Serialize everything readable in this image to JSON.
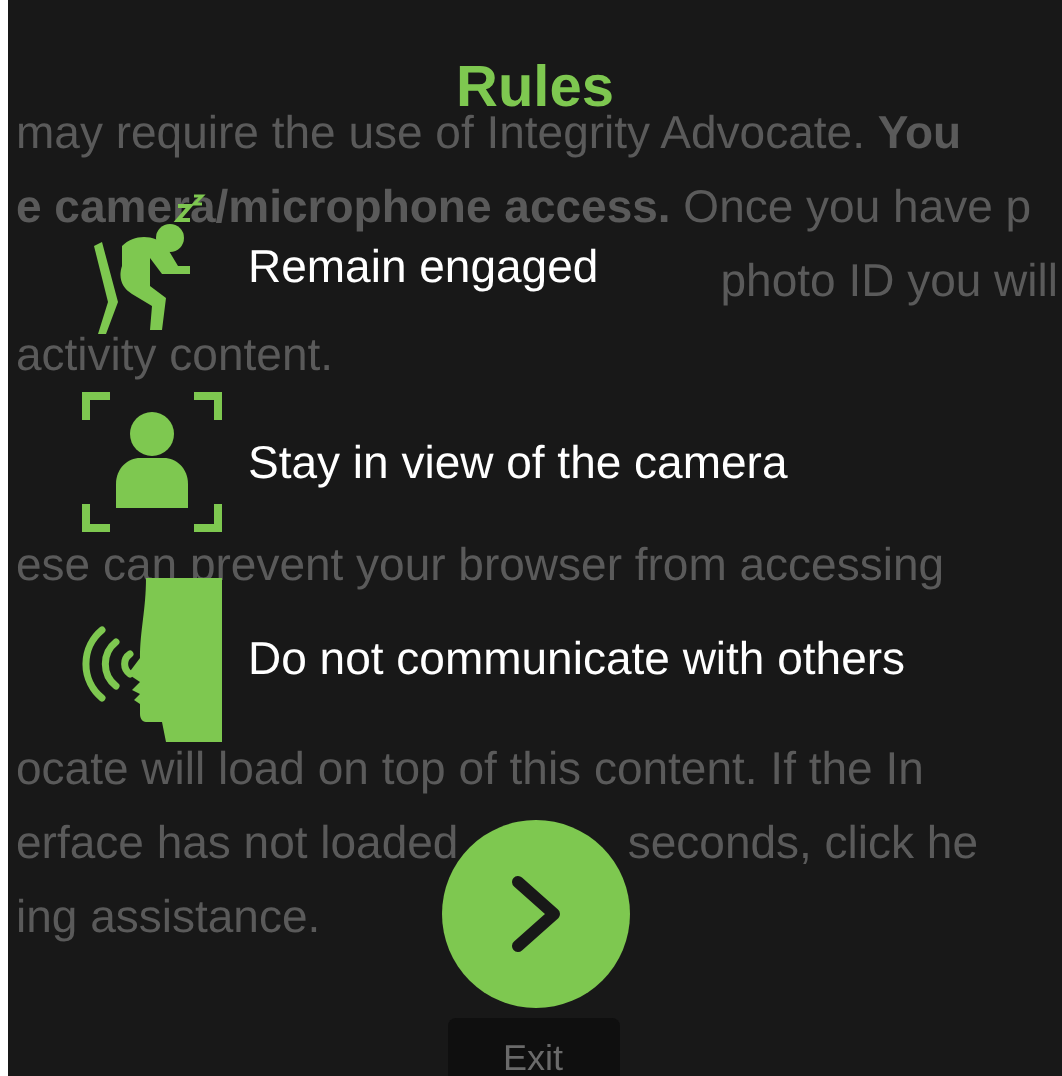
{
  "background_text": {
    "lines": [
      {
        "segments": [
          "may require the use of Integrity Advocate. **You**"
        ]
      },
      {
        "segments": [
          "**e camera/microphone access.** Once you have p"
        ]
      },
      {
        "segments": [
          "photo ID you will"
        ]
      },
      {
        "segments": [
          "activity content."
        ]
      },
      {
        "segments": [
          "ese can prevent your browser from accessing"
        ]
      },
      {
        "segments": [
          "ocate will load on top of this content. If the In"
        ]
      },
      {
        "segments": [
          "erface has not loaded",
          "seconds, click he"
        ]
      },
      {
        "segments": [
          "ing assistance."
        ]
      }
    ],
    "exit_button": "Exit"
  },
  "dialog": {
    "title": "Rules",
    "rules": [
      {
        "kind": "sleeping",
        "text": "Remain engaged"
      },
      {
        "kind": "camera",
        "text": "Stay in view of the camera"
      },
      {
        "kind": "speaking",
        "text": "Do not communicate with others"
      }
    ]
  }
}
